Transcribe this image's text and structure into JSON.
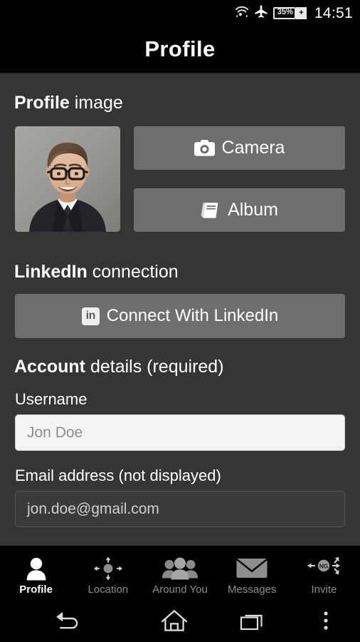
{
  "status_bar": {
    "wifi_icon": "wifi-icon",
    "airplane_icon": "airplane-mode-icon",
    "battery_percent": "35%",
    "battery_charging_glyph": "+",
    "time": "14:51"
  },
  "header": {
    "title": "Profile"
  },
  "sections": {
    "profile_image": {
      "heading_bold": "Profile",
      "heading_light": " image",
      "camera_button": "Camera",
      "album_button": "Album"
    },
    "linkedin": {
      "heading_bold": "LinkedIn",
      "heading_light": " connection",
      "connect_button": "Connect With LinkedIn",
      "badge_text": "in"
    },
    "account": {
      "heading_bold": "Account",
      "heading_light": " details (required)",
      "username_label": "Username",
      "username_placeholder": "Jon Doe",
      "username_value": "Jon Doe",
      "email_label": "Email address (not displayed)",
      "email_value": "jon.doe@gmail.com"
    }
  },
  "tab_bar": {
    "items": [
      {
        "label": "Profile",
        "icon": "person-icon",
        "active": true
      },
      {
        "label": "Location",
        "icon": "locate-icon",
        "active": false
      },
      {
        "label": "Around You",
        "icon": "people-group-icon",
        "active": false
      },
      {
        "label": "Messages",
        "icon": "envelope-icon",
        "active": false
      },
      {
        "label": "Invite",
        "icon": "invite-ng-icon",
        "active": false
      }
    ],
    "invite_badge_text": "NG"
  },
  "nav_bar": {
    "back": "back-icon",
    "home": "home-icon",
    "recents": "recents-icon",
    "menu": "overflow-menu-icon"
  },
  "colors": {
    "background": "#353535",
    "bar": "#000000",
    "button": "#6e6e6e",
    "active_tab": "#ffffff",
    "inactive_tab": "#8d8d8d",
    "input_focused_bg": "#f4f4f4"
  }
}
